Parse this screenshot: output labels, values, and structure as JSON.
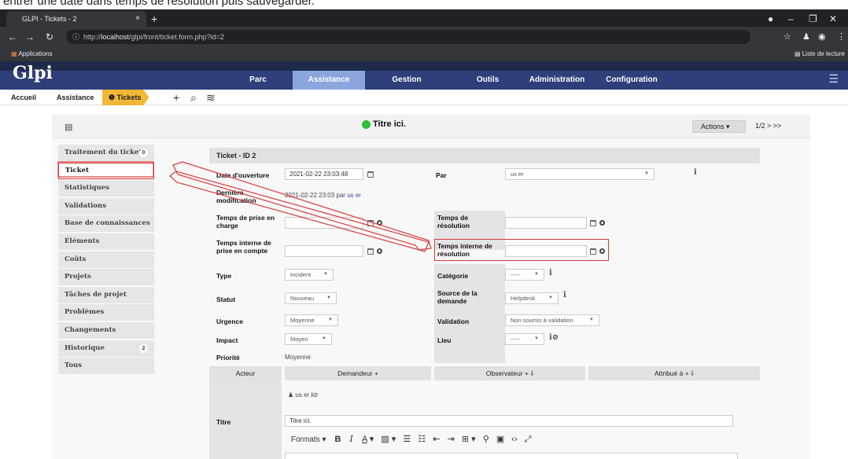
{
  "caption": "entrer une date dans temps de résolution puis sauvegarder.",
  "browser": {
    "tab_title": "GLPI - Tickets - 2",
    "tab_close": "×",
    "new_tab": "+",
    "url_prefix": "http://",
    "url_host": "localhost",
    "url_path": "/glpi/front/ticket.form.php?id=2",
    "apps_label": "Applications",
    "reading_list": "Liste de lecture"
  },
  "glpi": {
    "logo": "Glpi",
    "menu": [
      {
        "label": "Parc"
      },
      {
        "label": "Assistance"
      },
      {
        "label": "Gestion"
      },
      {
        "label": "Outils"
      },
      {
        "label": "Administration"
      },
      {
        "label": "Configuration"
      }
    ],
    "breadcrumb": {
      "home": "Accueil",
      "section": "Assistance",
      "current": "Tickets"
    }
  },
  "ticket": {
    "header_title": "Titre ici.",
    "actions_label": "Actions ▾",
    "pager": "1/2 > >>",
    "tabs": [
      {
        "label": "Traitement du ticket",
        "badge": "0"
      },
      {
        "label": "Ticket"
      },
      {
        "label": "Statistiques"
      },
      {
        "label": "Validations"
      },
      {
        "label": "Base de connaissances"
      },
      {
        "label": "Éléments"
      },
      {
        "label": "Coûts"
      },
      {
        "label": "Projets"
      },
      {
        "label": "Tâches de projet"
      },
      {
        "label": "Problèmes"
      },
      {
        "label": "Changements"
      },
      {
        "label": "Historique",
        "badge": "2"
      },
      {
        "label": "Tous"
      }
    ],
    "form": {
      "title": "Ticket - ID 2",
      "opening_label": "Date d'ouverture",
      "opening_value": "2021-02-22 23:03:48",
      "by_label": "Par",
      "by_value": "us er",
      "lastmod_label": "Dernière modification",
      "lastmod_value": "2021-02-22 23:03 par",
      "lastmod_user": "us er",
      "take_label": "Temps de prise en charge",
      "resolve_label": "Temps de résolution",
      "internal_take_label": "Temps interne de prise en compte",
      "internal_resolve_label": "Temps interne de résolution",
      "type_label": "Type",
      "type_value": "Incident",
      "category_label": "Catégorie",
      "category_value": "-----",
      "status_label": "Statut",
      "status_value": "Nouveau",
      "source_label": "Source de la demande",
      "source_value": "Helpdesk",
      "urgency_label": "Urgence",
      "urgency_value": "Moyenne",
      "validation_label": "Validation",
      "validation_value": "Non soumis à validation",
      "impact_label": "Impact",
      "impact_value": "Moyen",
      "location_label": "Lieu",
      "location_value": "-----",
      "priority_label": "Priorité",
      "priority_value": "Moyenne",
      "actor_label": "Acteur",
      "requester_label": "Demandeur +",
      "observer_label": "Observateur + ⸸",
      "assigned_label": "Attribué à + ⸸",
      "requester_user": "us er",
      "title_label": "Titre",
      "title_value": "Titre ici.",
      "formats_label": "Formats ▾"
    }
  },
  "colors": {
    "nav_dark": "#1f2a4a",
    "nav_strip": "#2e3f7a",
    "nav_active": "#8aa6dd",
    "tickets_tab": "#f2b737",
    "highlight_red": "#d93a3a",
    "status_green": "#2dbf3a"
  }
}
